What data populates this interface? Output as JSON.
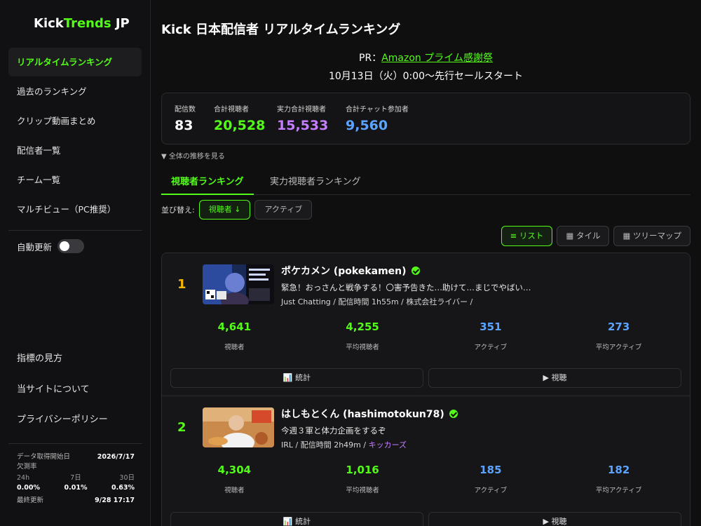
{
  "sidebar": {
    "logo_part1": "Kick",
    "logo_part2": "Trends",
    "logo_part3": " JP",
    "nav": [
      {
        "label": "リアルタイムランキング"
      },
      {
        "label": "過去のランキング"
      },
      {
        "label": "クリップ動画まとめ"
      },
      {
        "label": "配信者一覧"
      },
      {
        "label": "チーム一覧"
      },
      {
        "label": "マルチビュー（PC推奨）"
      }
    ],
    "auto_update_label": "自動更新",
    "auto_update_on": false,
    "bottom_nav": [
      {
        "label": "指標の見方"
      },
      {
        "label": "当サイトについて"
      },
      {
        "label": "プライバシーポリシー"
      }
    ],
    "stats": {
      "start_label": "データ取得開始日",
      "start_value": "2026/7/17",
      "missing_label": "欠測率",
      "cols": [
        {
          "label": "24h",
          "value": "0.00%"
        },
        {
          "label": "7日",
          "value": "0.01%"
        },
        {
          "label": "30日",
          "value": "0.63%"
        }
      ],
      "updated_label": "最終更新",
      "updated_value": "9/28 17:17"
    }
  },
  "main": {
    "title": "Kick 日本配信者 リアルタイムランキング",
    "pr_prefix": "PR：",
    "pr_link": "Amazon プライム感謝祭",
    "pr_line2": "10月13日（火）0:00〜先行セールスタート",
    "summary": [
      {
        "label": "配信数",
        "value": "83",
        "color": "#ffffff"
      },
      {
        "label": "合計視聴者",
        "value": "20,528",
        "color": "#53fc18"
      },
      {
        "label": "実力合計視聴者",
        "value": "15,533",
        "color": "#c77dff"
      },
      {
        "label": "合計チャット参加者",
        "value": "9,560",
        "color": "#5ba4ff"
      }
    ],
    "trend_link": "▼ 全体の推移を見る",
    "tabs": [
      {
        "label": "視聴者ランキング"
      },
      {
        "label": "実力視聴者ランキング"
      }
    ],
    "sort_label": "並び替え:",
    "sort_options": [
      {
        "label": "視聴者 ↓"
      },
      {
        "label": "アクティブ"
      }
    ],
    "views": [
      {
        "label": "≡ リスト"
      },
      {
        "label": "▦ タイル"
      },
      {
        "label": "▦ ツリーマップ"
      }
    ]
  },
  "streams": [
    {
      "rank": "1",
      "name": "ポケカメン (pokekamen)",
      "title": "緊急！おっさんと戦争する！〇害予告きた…助けて…まじでやばい…",
      "category": "Just Chatting",
      "duration": "配信時間 1h55m",
      "team": "株式会社ライバー",
      "metrics": [
        {
          "value": "4,641",
          "label": "視聴者"
        },
        {
          "value": "4,255",
          "label": "平均視聴者"
        },
        {
          "value": "351",
          "label": "アクティブ"
        },
        {
          "value": "273",
          "label": "平均アクティブ"
        }
      ],
      "stats_button": "📊 統計",
      "watch_button": "▶ 視聴"
    },
    {
      "rank": "2",
      "name": "はしもとくん (hashimotokun78)",
      "title": "今週３軍と体力企画をするぞ",
      "category": "IRL",
      "duration": "配信時間 2h49m",
      "team": "キッカーズ",
      "metrics": [
        {
          "value": "4,304",
          "label": "視聴者"
        },
        {
          "value": "1,016",
          "label": "平均視聴者"
        },
        {
          "value": "185",
          "label": "アクティブ"
        },
        {
          "value": "182",
          "label": "平均アクティブ"
        }
      ],
      "stats_button": "📊 統計",
      "watch_button": "▶ 視聴"
    }
  ]
}
